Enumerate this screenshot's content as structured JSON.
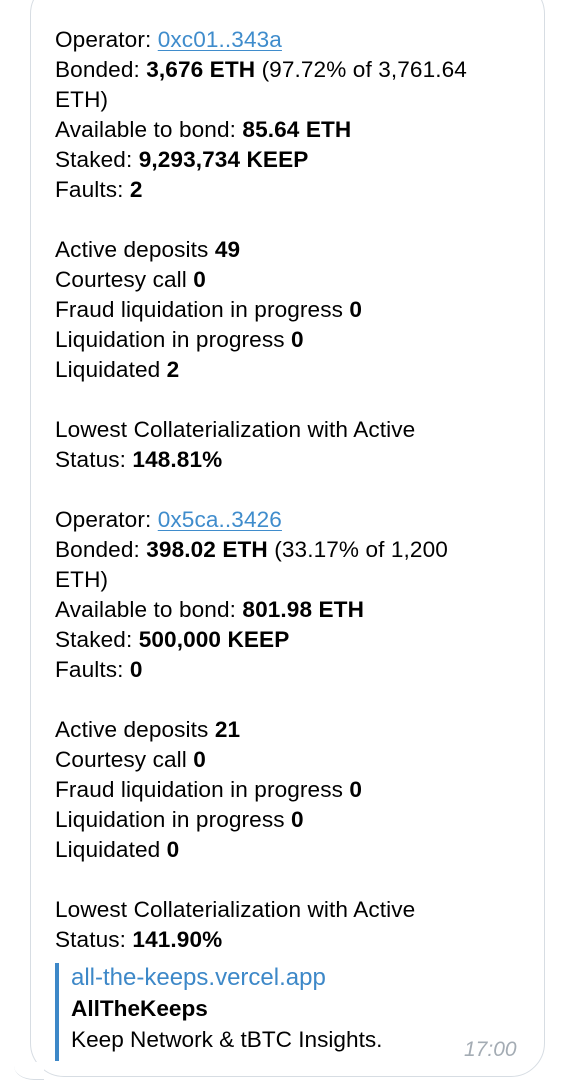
{
  "operators": [
    {
      "operator_label": "Operator:",
      "operator_address": "0xc01..343a",
      "bonded_label": "Bonded:",
      "bonded_value": "3,676 ETH",
      "bonded_pct_a": "(97.72% of 3,761.64",
      "bonded_pct_b": "ETH)",
      "available_label": "Available to bond:",
      "available_value": "85.64 ETH",
      "staked_label": "Staked:",
      "staked_value": "9,293,734 KEEP",
      "faults_label": "Faults:",
      "faults_value": "2",
      "active_label": "Active deposits",
      "active_value": "49",
      "courtesy_label": "Courtesy call",
      "courtesy_value": "0",
      "fraud_label": "Fraud liquidation in progress",
      "fraud_value": "0",
      "liq_prog_label": "Liquidation in progress",
      "liq_prog_value": "0",
      "liquidated_label": "Liquidated",
      "liquidated_value": "2",
      "lowest_label_a": "Lowest Collaterialization with Active",
      "lowest_label_b": "Status:",
      "lowest_value": "148.81%"
    },
    {
      "operator_label": "Operator:",
      "operator_address": "0x5ca..3426",
      "bonded_label": "Bonded:",
      "bonded_value": "398.02 ETH",
      "bonded_pct_a": "(33.17% of 1,200",
      "bonded_pct_b": "ETH)",
      "available_label": "Available to bond:",
      "available_value": "801.98 ETH",
      "staked_label": "Staked:",
      "staked_value": "500,000 KEEP",
      "faults_label": "Faults:",
      "faults_value": "0",
      "active_label": "Active deposits",
      "active_value": "21",
      "courtesy_label": "Courtesy call",
      "courtesy_value": "0",
      "fraud_label": "Fraud liquidation in progress",
      "fraud_value": "0",
      "liq_prog_label": "Liquidation in progress",
      "liq_prog_value": "0",
      "liquidated_label": "Liquidated",
      "liquidated_value": "0",
      "lowest_label_a": "Lowest Collaterialization with Active",
      "lowest_label_b": "Status:",
      "lowest_value": "141.90%"
    }
  ],
  "preview": {
    "site": "all-the-keeps.vercel.app",
    "title": "AllTheKeeps",
    "description": "Keep Network & tBTC Insights."
  },
  "message_time": "17:00",
  "colors": {
    "link": "#3f8ccc",
    "preview_bar": "#3d88c8",
    "bubble_border": "#d7dde3",
    "time": "#a4acb4"
  }
}
